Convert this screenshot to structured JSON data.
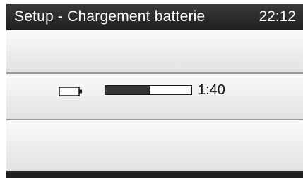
{
  "header": {
    "title": "Setup - Chargement batterie",
    "clock": "22:12"
  },
  "charging": {
    "icon": "battery-icon",
    "progress_fraction": 0.52,
    "time_remaining": "1:40"
  },
  "colors": {
    "title_bar": "#2b2b2b",
    "panel": "#f1f1f1",
    "progress_fill": "#333333"
  }
}
